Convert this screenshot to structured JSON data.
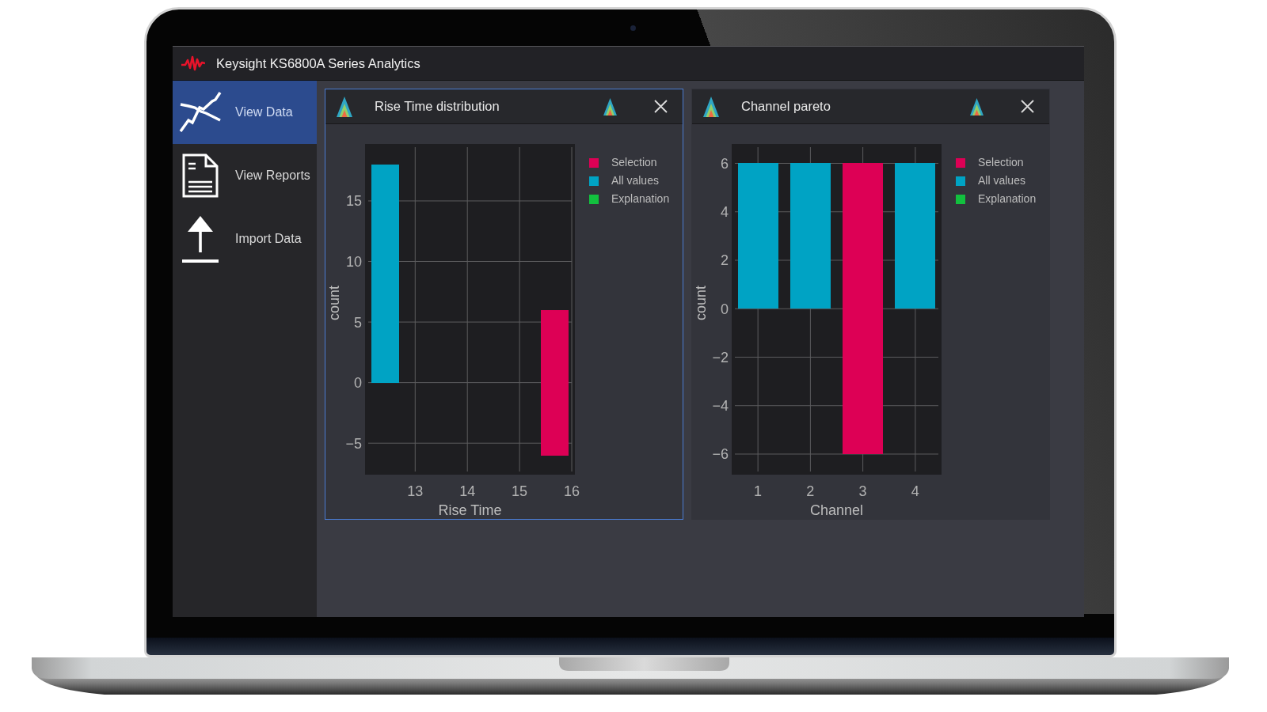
{
  "window": {
    "title": "Keysight KS6800A Series Analytics"
  },
  "sidebar": {
    "items": [
      {
        "label": "View Data",
        "selected": true
      },
      {
        "label": "View Reports",
        "selected": false
      },
      {
        "label": "Import Data",
        "selected": false
      }
    ]
  },
  "panels": [
    {
      "title": "Rise Time distribution",
      "selected": true,
      "chart_data": {
        "type": "bar",
        "xlabel": "Rise Time",
        "ylabel": "count",
        "x": [
          12.43,
          15.67
        ],
        "grid": true,
        "stacked": true,
        "series": [
          {
            "name": "Selection",
            "color": "#dd0055",
            "values": [
              null,
              6
            ]
          },
          {
            "name": "All values",
            "color": "#00a3c4",
            "values": [
              18,
              null
            ]
          },
          {
            "name": "Explanation",
            "color": "#12c03e",
            "values": [
              null,
              null
            ]
          },
          {
            "color": "#dd0055",
            "values": [
              null,
              -6
            ]
          }
        ],
        "xlim": [
          12.04,
          16.06
        ],
        "ylim": [
          -7.6,
          19.7
        ],
        "xticks": [
          13,
          14,
          15,
          16
        ],
        "yticks": [
          {
            "value": -5,
            "label": "−5"
          },
          0,
          5,
          10,
          15
        ]
      }
    },
    {
      "title": "Channel pareto",
      "selected": false,
      "chart_data": {
        "type": "bar",
        "xlabel": "Channel",
        "ylabel": "count",
        "categories": [
          "1",
          "2",
          "3",
          "4"
        ],
        "grid": true,
        "stacked": true,
        "series": [
          {
            "name": "Selection",
            "color": "#dd0055",
            "values": [
              null,
              null,
              6,
              null
            ]
          },
          {
            "name": "All values",
            "color": "#00a3c4",
            "values": [
              6,
              6,
              null,
              6
            ]
          },
          {
            "name": "Explanation",
            "color": "#12c03e",
            "values": [
              null,
              null,
              null,
              null
            ]
          },
          {
            "color": "#dd0055",
            "values": [
              null,
              null,
              -6,
              null
            ]
          }
        ],
        "ylim": [
          -6.85,
          6.8
        ],
        "yticks": [
          {
            "value": -6,
            "label": "−6"
          },
          {
            "value": -4,
            "label": "−4"
          },
          {
            "value": -2,
            "label": "−2"
          },
          0,
          2,
          4,
          6
        ]
      }
    }
  ]
}
